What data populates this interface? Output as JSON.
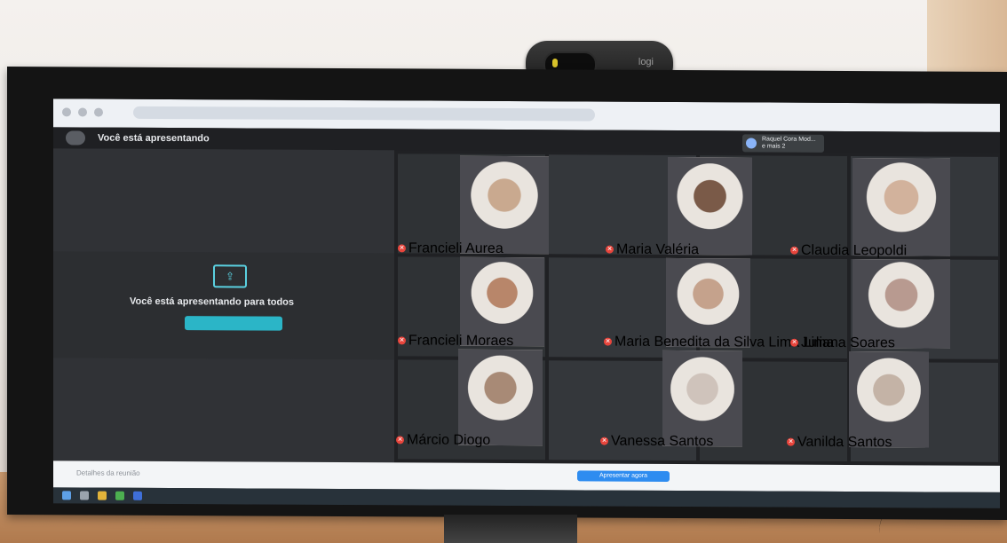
{
  "webcam": {
    "brand": "logi"
  },
  "meeting": {
    "presenting_label": "Você está apresentando",
    "share_message": "Você está apresentando para todos",
    "stop_button_label": "",
    "present_now_label": "Apresentar agora",
    "details_label": "Detalhes da reunião"
  },
  "chip": {
    "line1": "Raquel Cora Mod...",
    "line2": "e mais 2"
  },
  "participants": [
    {
      "name": "Francieli Aurea",
      "face": "#c9a98f"
    },
    {
      "name": "Maria Valéria",
      "face": "#7a5a48"
    },
    {
      "name": "Claudia Leopoldi",
      "face": "#d2b29c"
    },
    {
      "name": "Francieli Moraes",
      "face": "#b8866a"
    },
    {
      "name": "Maria Benedita da Silva Lima Lima",
      "face": "#c5a28c"
    },
    {
      "name": "Juliana Soares",
      "face": "#b89a90"
    },
    {
      "name": "Márcio Diogo",
      "face": "#a88a76"
    },
    {
      "name": "Vanessa Santos",
      "face": "#cfc3bb"
    },
    {
      "name": "Vanilda Santos",
      "face": "#c4b3a6"
    }
  ],
  "colors": {
    "accent": "#2bb5c7",
    "mic_off": "#e8453c",
    "present_button": "#2e8cf0"
  },
  "icons": {
    "presenting": "present-screen-icon",
    "mic": "mic-off-icon"
  }
}
